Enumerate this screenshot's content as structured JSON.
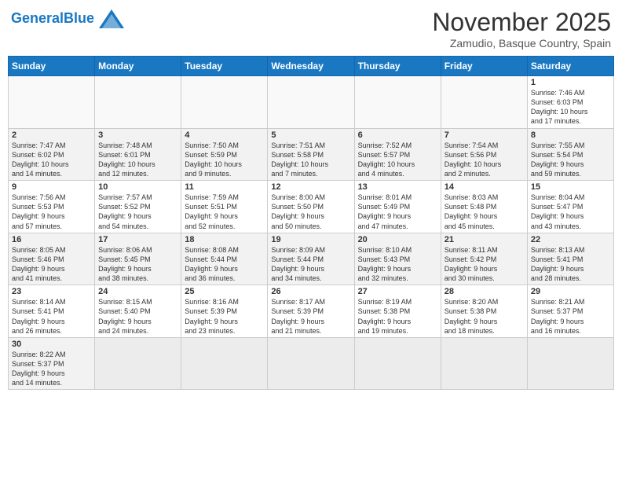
{
  "header": {
    "logo_general": "General",
    "logo_blue": "Blue",
    "month_title": "November 2025",
    "location": "Zamudio, Basque Country, Spain"
  },
  "weekdays": [
    "Sunday",
    "Monday",
    "Tuesday",
    "Wednesday",
    "Thursday",
    "Friday",
    "Saturday"
  ],
  "weeks": [
    [
      {
        "day": "",
        "info": ""
      },
      {
        "day": "",
        "info": ""
      },
      {
        "day": "",
        "info": ""
      },
      {
        "day": "",
        "info": ""
      },
      {
        "day": "",
        "info": ""
      },
      {
        "day": "",
        "info": ""
      },
      {
        "day": "1",
        "info": "Sunrise: 7:46 AM\nSunset: 6:03 PM\nDaylight: 10 hours\nand 17 minutes."
      }
    ],
    [
      {
        "day": "2",
        "info": "Sunrise: 7:47 AM\nSunset: 6:02 PM\nDaylight: 10 hours\nand 14 minutes."
      },
      {
        "day": "3",
        "info": "Sunrise: 7:48 AM\nSunset: 6:01 PM\nDaylight: 10 hours\nand 12 minutes."
      },
      {
        "day": "4",
        "info": "Sunrise: 7:50 AM\nSunset: 5:59 PM\nDaylight: 10 hours\nand 9 minutes."
      },
      {
        "day": "5",
        "info": "Sunrise: 7:51 AM\nSunset: 5:58 PM\nDaylight: 10 hours\nand 7 minutes."
      },
      {
        "day": "6",
        "info": "Sunrise: 7:52 AM\nSunset: 5:57 PM\nDaylight: 10 hours\nand 4 minutes."
      },
      {
        "day": "7",
        "info": "Sunrise: 7:54 AM\nSunset: 5:56 PM\nDaylight: 10 hours\nand 2 minutes."
      },
      {
        "day": "8",
        "info": "Sunrise: 7:55 AM\nSunset: 5:54 PM\nDaylight: 9 hours\nand 59 minutes."
      }
    ],
    [
      {
        "day": "9",
        "info": "Sunrise: 7:56 AM\nSunset: 5:53 PM\nDaylight: 9 hours\nand 57 minutes."
      },
      {
        "day": "10",
        "info": "Sunrise: 7:57 AM\nSunset: 5:52 PM\nDaylight: 9 hours\nand 54 minutes."
      },
      {
        "day": "11",
        "info": "Sunrise: 7:59 AM\nSunset: 5:51 PM\nDaylight: 9 hours\nand 52 minutes."
      },
      {
        "day": "12",
        "info": "Sunrise: 8:00 AM\nSunset: 5:50 PM\nDaylight: 9 hours\nand 50 minutes."
      },
      {
        "day": "13",
        "info": "Sunrise: 8:01 AM\nSunset: 5:49 PM\nDaylight: 9 hours\nand 47 minutes."
      },
      {
        "day": "14",
        "info": "Sunrise: 8:03 AM\nSunset: 5:48 PM\nDaylight: 9 hours\nand 45 minutes."
      },
      {
        "day": "15",
        "info": "Sunrise: 8:04 AM\nSunset: 5:47 PM\nDaylight: 9 hours\nand 43 minutes."
      }
    ],
    [
      {
        "day": "16",
        "info": "Sunrise: 8:05 AM\nSunset: 5:46 PM\nDaylight: 9 hours\nand 41 minutes."
      },
      {
        "day": "17",
        "info": "Sunrise: 8:06 AM\nSunset: 5:45 PM\nDaylight: 9 hours\nand 38 minutes."
      },
      {
        "day": "18",
        "info": "Sunrise: 8:08 AM\nSunset: 5:44 PM\nDaylight: 9 hours\nand 36 minutes."
      },
      {
        "day": "19",
        "info": "Sunrise: 8:09 AM\nSunset: 5:44 PM\nDaylight: 9 hours\nand 34 minutes."
      },
      {
        "day": "20",
        "info": "Sunrise: 8:10 AM\nSunset: 5:43 PM\nDaylight: 9 hours\nand 32 minutes."
      },
      {
        "day": "21",
        "info": "Sunrise: 8:11 AM\nSunset: 5:42 PM\nDaylight: 9 hours\nand 30 minutes."
      },
      {
        "day": "22",
        "info": "Sunrise: 8:13 AM\nSunset: 5:41 PM\nDaylight: 9 hours\nand 28 minutes."
      }
    ],
    [
      {
        "day": "23",
        "info": "Sunrise: 8:14 AM\nSunset: 5:41 PM\nDaylight: 9 hours\nand 26 minutes."
      },
      {
        "day": "24",
        "info": "Sunrise: 8:15 AM\nSunset: 5:40 PM\nDaylight: 9 hours\nand 24 minutes."
      },
      {
        "day": "25",
        "info": "Sunrise: 8:16 AM\nSunset: 5:39 PM\nDaylight: 9 hours\nand 23 minutes."
      },
      {
        "day": "26",
        "info": "Sunrise: 8:17 AM\nSunset: 5:39 PM\nDaylight: 9 hours\nand 21 minutes."
      },
      {
        "day": "27",
        "info": "Sunrise: 8:19 AM\nSunset: 5:38 PM\nDaylight: 9 hours\nand 19 minutes."
      },
      {
        "day": "28",
        "info": "Sunrise: 8:20 AM\nSunset: 5:38 PM\nDaylight: 9 hours\nand 18 minutes."
      },
      {
        "day": "29",
        "info": "Sunrise: 8:21 AM\nSunset: 5:37 PM\nDaylight: 9 hours\nand 16 minutes."
      }
    ],
    [
      {
        "day": "30",
        "info": "Sunrise: 8:22 AM\nSunset: 5:37 PM\nDaylight: 9 hours\nand 14 minutes."
      },
      {
        "day": "",
        "info": ""
      },
      {
        "day": "",
        "info": ""
      },
      {
        "day": "",
        "info": ""
      },
      {
        "day": "",
        "info": ""
      },
      {
        "day": "",
        "info": ""
      },
      {
        "day": "",
        "info": ""
      }
    ]
  ]
}
